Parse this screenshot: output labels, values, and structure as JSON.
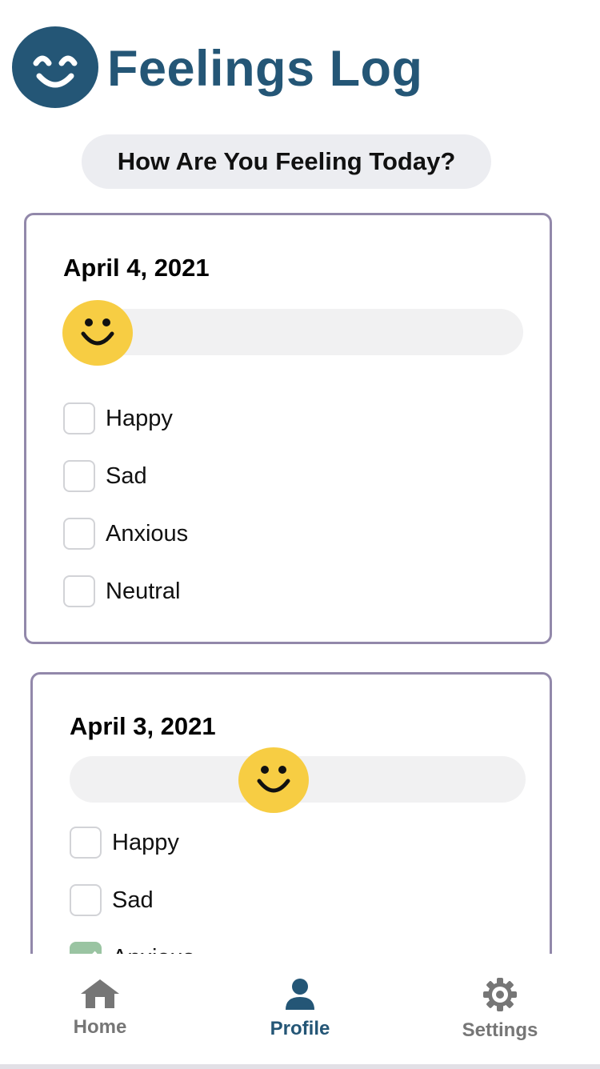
{
  "header": {
    "title": "Feelings Log",
    "logo_icon": "smiley-icon",
    "accent_color": "#245676"
  },
  "prompt": {
    "text": "How Are You Feeling Today?"
  },
  "entries": [
    {
      "date": "April 4, 2021",
      "mood_slider_value": 0,
      "options": [
        {
          "label": "Happy",
          "checked": false
        },
        {
          "label": "Sad",
          "checked": false
        },
        {
          "label": "Anxious",
          "checked": false
        },
        {
          "label": "Neutral",
          "checked": false
        }
      ]
    },
    {
      "date": "April 3, 2021",
      "mood_slider_value": 0.45,
      "options": [
        {
          "label": "Happy",
          "checked": false
        },
        {
          "label": "Sad",
          "checked": false
        },
        {
          "label": "Anxious",
          "checked": true
        }
      ]
    }
  ],
  "nav": {
    "items": [
      {
        "label": "Home",
        "icon": "home-icon",
        "active": false
      },
      {
        "label": "Profile",
        "icon": "user-icon",
        "active": true
      },
      {
        "label": "Settings",
        "icon": "gear-icon",
        "active": false
      }
    ]
  },
  "colors": {
    "card_border": "#9288aa",
    "thumb": "#f7cd43",
    "checked": "#9ac4a2",
    "nav_inactive": "#767676"
  }
}
